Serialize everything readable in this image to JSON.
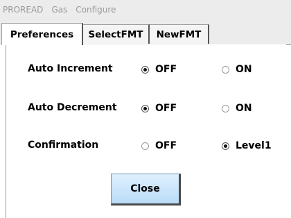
{
  "menubar": {
    "items": [
      "PROREAD",
      "Gas",
      "Configure"
    ]
  },
  "tabs": [
    {
      "label": "Preferences",
      "active": true
    },
    {
      "label": "SelectFMT",
      "active": false
    },
    {
      "label": "NewFMT",
      "active": false
    }
  ],
  "settings": [
    {
      "label": "Auto Increment",
      "options": [
        {
          "label": "OFF",
          "selected": true
        },
        {
          "label": "ON",
          "selected": false
        }
      ]
    },
    {
      "label": "Auto Decrement",
      "options": [
        {
          "label": "OFF",
          "selected": true
        },
        {
          "label": "ON",
          "selected": false
        }
      ]
    },
    {
      "label": "Confirmation",
      "options": [
        {
          "label": "OFF",
          "selected": false
        },
        {
          "label": "Level1",
          "selected": true
        }
      ]
    }
  ],
  "close_button": {
    "label": "Close"
  },
  "colors": {
    "button_top": "#dff0ff",
    "button_bottom": "#b9dcf7",
    "menu_text": "#9a9a9a"
  }
}
